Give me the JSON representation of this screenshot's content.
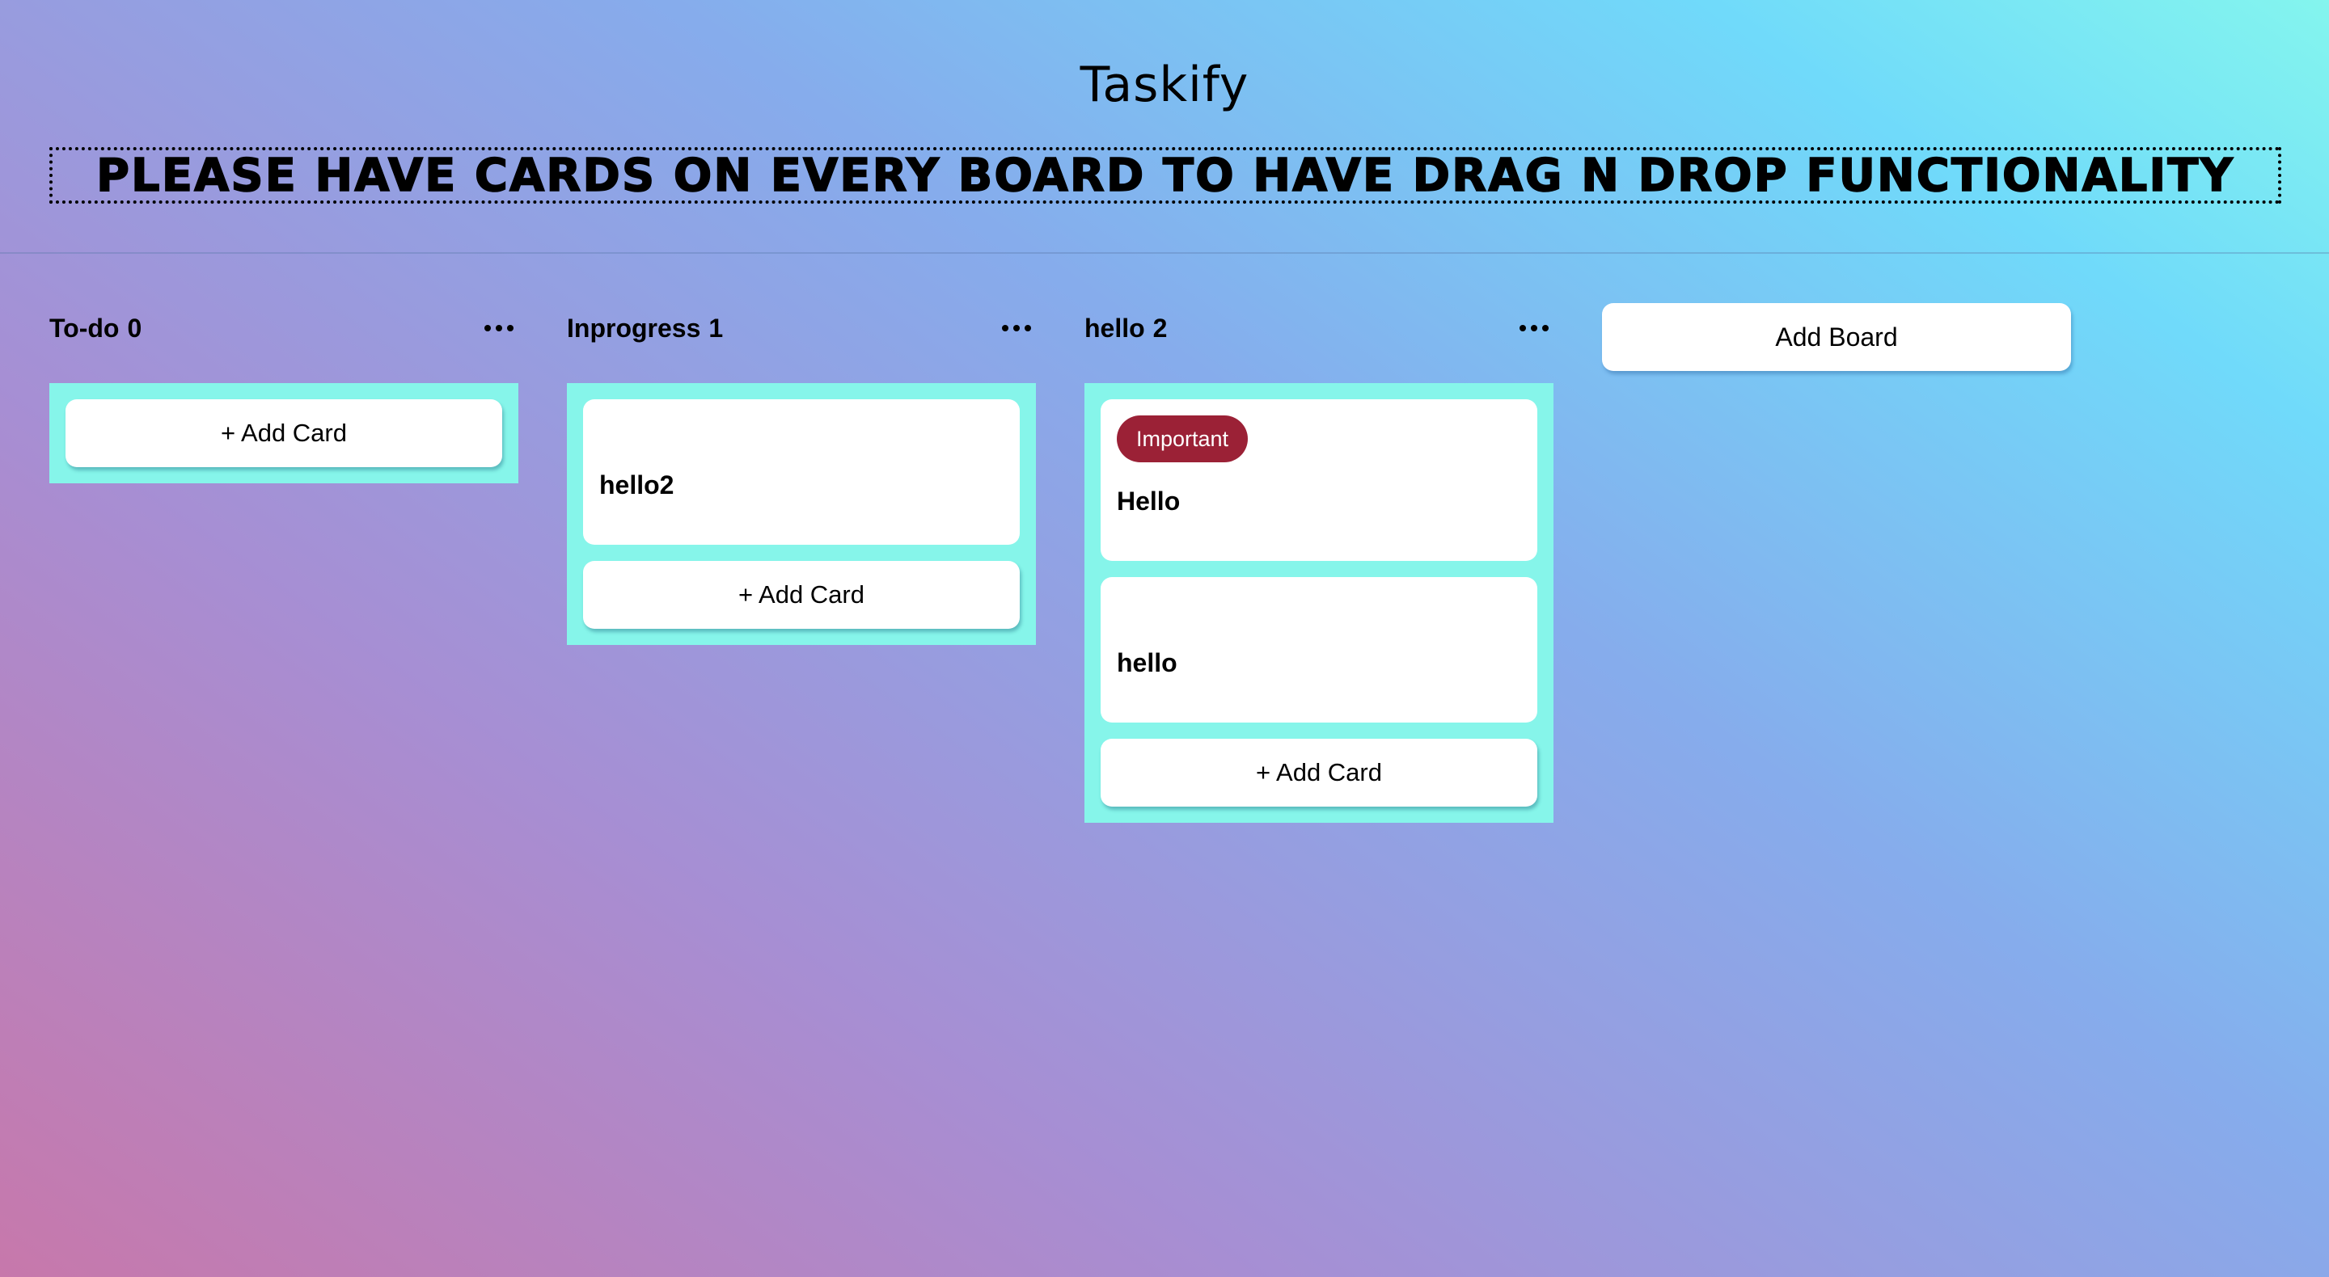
{
  "app": {
    "title": "Taskify",
    "notice": "PLEASE HAVE CARDS ON EVERY BOARD TO HAVE DRAG N DROP FUNCTIONALITY"
  },
  "boards": [
    {
      "title": "To-do",
      "count": "0",
      "cards": [],
      "add_card_label": "+ Add Card"
    },
    {
      "title": "Inprogress",
      "count": "1",
      "cards": [
        {
          "title": "hello2",
          "labels": []
        }
      ],
      "add_card_label": "+ Add Card"
    },
    {
      "title": "hello",
      "count": "2",
      "cards": [
        {
          "title": "Hello",
          "labels": [
            {
              "text": "Important",
              "color": "#9b2136"
            }
          ]
        },
        {
          "title": "hello",
          "labels": []
        }
      ],
      "add_card_label": "+ Add Card"
    }
  ],
  "add_board_label": "Add Board",
  "colors": {
    "board_body": "#86f5ea",
    "card": "#ffffff",
    "important_label": "#9b2136"
  },
  "icons": {
    "board_menu": "more-horizontal-icon"
  }
}
